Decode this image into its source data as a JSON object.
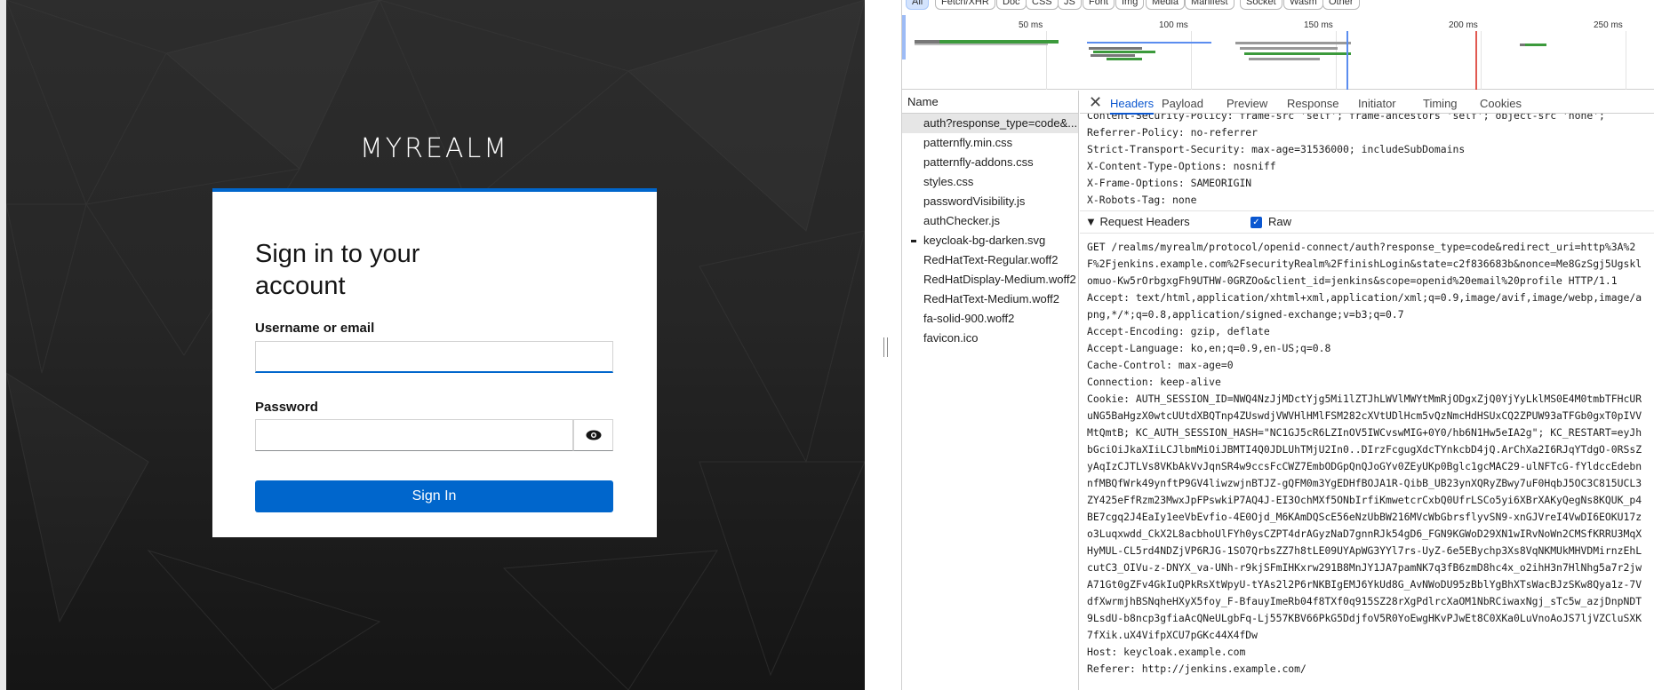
{
  "login": {
    "realm_title": "MYREALM",
    "heading": "Sign in to your account",
    "username_label": "Username or email",
    "username_value": "",
    "password_label": "Password",
    "password_value": "",
    "signin_button": "Sign In",
    "accent_color": "#0066cc"
  },
  "devtools": {
    "filters": [
      "All",
      "Fetch/XHR",
      "Doc",
      "CSS",
      "JS",
      "Font",
      "Img",
      "Media",
      "Manifest",
      "Socket",
      "Wasm",
      "Other"
    ],
    "active_filter": "All",
    "timeline_ticks": [
      "50 ms",
      "100 ms",
      "150 ms",
      "200 ms",
      "250 ms"
    ],
    "name_header": "Name",
    "requests": [
      "auth?response_type=code&...",
      "patternfly.min.css",
      "patternfly-addons.css",
      "styles.css",
      "passwordVisibility.js",
      "authChecker.js",
      "keycloak-bg-darken.svg",
      "RedHatText-Regular.woff2",
      "RedHatDisplay-Medium.woff2",
      "RedHatText-Medium.woff2",
      "fa-solid-900.woff2",
      "favicon.ico"
    ],
    "selected_request": "auth?response_type=code&...",
    "tabs": [
      "Headers",
      "Payload",
      "Preview",
      "Response",
      "Initiator",
      "Timing",
      "Cookies"
    ],
    "active_tab": "Headers",
    "response_headers": [
      "Content-Security-Policy: frame-src 'self'; frame-ancestors 'self'; object-src 'none';",
      "Referrer-Policy: no-referrer",
      "Strict-Transport-Security: max-age=31536000; includeSubDomains",
      "X-Content-Type-Options: nosniff",
      "X-Frame-Options: SAMEORIGIN",
      "X-Robots-Tag: none"
    ],
    "request_headers_title": "▼ Request Headers",
    "raw_label": "Raw",
    "raw_checked": true,
    "request_raw": [
      "GET /realms/myrealm/protocol/openid-connect/auth?response_type=code&redirect_uri=http%3A%2F%2Fjenkins.example.com%2FsecurityRealm%2FfinishLogin&state=c2f836683b&nonce=Me8GzSgj5Ugsklomuo-Kw5rOrbgxgFh9UTHW-0GRZOo&client_id=jenkins&scope=openid%20email%20profile HTTP/1.1",
      "Accept: text/html,application/xhtml+xml,application/xml;q=0.9,image/avif,image/webp,image/apng,*/*;q=0.8,application/signed-exchange;v=b3;q=0.7",
      "Accept-Encoding: gzip, deflate",
      "Accept-Language: ko,en;q=0.9,en-US;q=0.8",
      "Cache-Control: max-age=0",
      "Connection: keep-alive",
      "Cookie: AUTH_SESSION_ID=NWQ4NzJjMDctYjg5Mi1lZTJhLWVlMWYtMmRjODgxZjQ0YjYyLklMS0E4M0tmbTFHcURuNG5BaHgzX0wtcUUtdXBQTnp4ZUswdjVWVHlHMlFSM282cXVtUDlHcm5vQzNmcHdHSUxCQ2ZPUW93aTFGb0gxT0pIVVMtQmtB; KC_AUTH_SESSION_HASH=\"NC1GJ5cR6LZInOV5IWCvswMIG+0Y0/hb6N1Hw5eIA2g\"; KC_RESTART=eyJhbGciOiJkaXIiLCJlbmMiOiJBMTI4Q0JDLUhTMjU2In0..DIrzFcgugXdcTYnkcbD4jQ.ArChXa2I6RJqYTdgO-0RSsZyAqIzCJTLVs8VKbAkVvJqnSR4w9ccsFcCWZ7EmbODGpQnQJoGYv0ZEyUKp0Bglc1gcMAC29-ulNFTcG-fYldccEdebnnfMBQfWrk49ynftP9GV4liwzwjnBTJZ-gQFM0m3YgEDHfBOJA1R-QibB_UB23ynXQRyZBwy7uF0HqbJ5OC3C815UCL3ZY425eFfRzm23MwxJpFPswkiP7AQ4J-EI3OchMXf5ONbIrfiKmwetcrCxbQ0UfrLSCo5yi6XBrXAKyQegNs8KQUK_p4BE7cgq2J4EaIy1eeVbEvfio-4E0Ojd_M6KAmDQScE56eNzUbBW216MVcWbGbrsflyvSN9-xnGJVreI4VwDI6EOKU17zo3Luqxwdd_CkX2L8acbhoUlFYh0ysCZPT4drAGyzNaD7gnnRJk54gD6_FGN9KGWoD29XN1wIRvNoWn2CMSfKRRU3MqXHyMUL-CL5rd4NDZjVP6RJG-1SO7QrbsZZ7h8tLE09UYApWG3YYl7rs-UyZ-6e5EBychp3Xs8VqNKMUkMHVDMirnzEhLcutC3_OIVu-z-DNYX_va-UNh-r9kjSFmIHKxrw291B8MnJY1JA7pamNK7q3fB6zmD8hc4x_o2ihH3n7HlNhg5a7r2jwA71Gt0gZFv4GkIuQPkRsXtWpyU-tYAs2l2P6rNKBIgEMJ6YkUd8G_AvNWoDU95zBblYgBhXTsWacBJzSKw8Qya1z-7VdfXwrmjhBSNqheHXyX5foy_F-BfauyImeRb04f8TXf0q915SZ28rXgPdlrcXaOM1NbRCiwaxNgj_sTc5w_azjDnpNDT9LsdU-b8ncp3gfiaAcQNeULgbFq-Lj557KBV66PkG5DdjfoV5R0YoEwgHKvPJwEt8C0XKa0LuVnoAoJS7ljVZCluSXK7fXik.uX4VifpXCU7pGKc44X4fDw",
      "Host: keycloak.example.com",
      "Referer: http://jenkins.example.com/"
    ]
  }
}
